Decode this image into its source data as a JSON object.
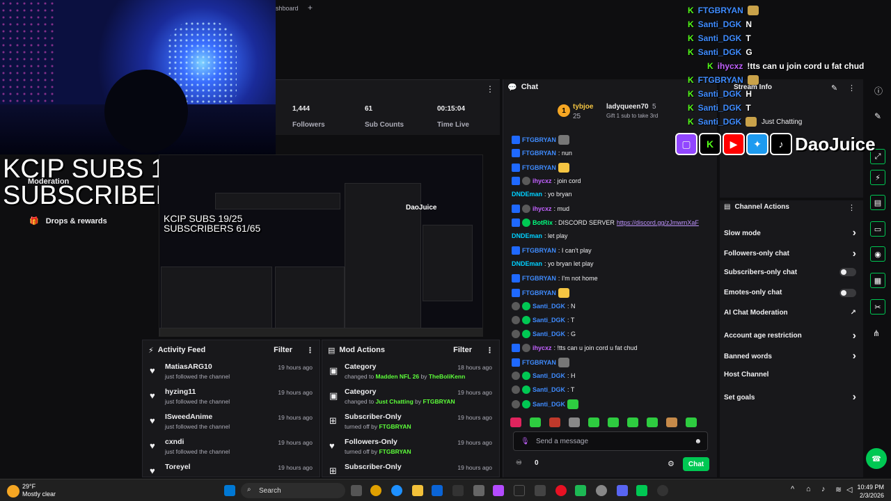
{
  "overlay": {
    "subs_line1": "KCIP SUBS 19/25",
    "subs_line2": "SUBSCRIBERS 61/65",
    "brand": "DaoJuice"
  },
  "top_chat_overlay": [
    {
      "user": "FTGBRYAN",
      "text": ""
    },
    {
      "user": "Santi_DGK",
      "text": "N"
    },
    {
      "user": "Santi_DGK",
      "text": "T"
    },
    {
      "user": "Santi_DGK",
      "text": "G"
    },
    {
      "user": "ihycxz",
      "text": "!tts can u join cord u fat chud"
    },
    {
      "user": "FTGBRYAN",
      "text": ""
    },
    {
      "user": "Santi_DGK",
      "text": "H"
    },
    {
      "user": "Santi_DGK",
      "text": "T"
    },
    {
      "user": "Santi_DGK",
      "text": ""
    }
  ],
  "browser": {
    "tab_label": "shboard"
  },
  "stats": [
    {
      "value": "1,444",
      "label": "Followers"
    },
    {
      "value": "61",
      "label": "Sub Counts"
    },
    {
      "value": "00:15:04",
      "label": "Time Live"
    }
  ],
  "sidebar": {
    "moderation": "Moderation",
    "drops": "Drops & rewards"
  },
  "activity_feed": {
    "title": "Activity Feed",
    "filter": "Filter",
    "items": [
      {
        "name": "MatiasARG10",
        "sub": "just followed the channel",
        "time": "19 hours ago"
      },
      {
        "name": "hyzing11",
        "sub": "just followed the channel",
        "time": "19 hours ago"
      },
      {
        "name": "ISweedAnime",
        "sub": "just followed the channel",
        "time": "19 hours ago"
      },
      {
        "name": "cxndi",
        "sub": "just followed the channel",
        "time": "19 hours ago"
      },
      {
        "name": "Toreyel",
        "sub": "",
        "time": "19 hours ago"
      }
    ]
  },
  "mod_actions": {
    "title": "Mod Actions",
    "filter": "Filter",
    "items": [
      {
        "name": "Category",
        "pre": "changed to",
        "highlight": "Madden NFL 26",
        "mid": "by",
        "who": "TheBoliKenn",
        "time": "18 hours ago"
      },
      {
        "name": "Category",
        "pre": "changed to",
        "highlight": "Just Chatting",
        "mid": "by",
        "who": "FTGBRYAN",
        "time": "19 hours ago"
      },
      {
        "name": "Subscriber-Only",
        "pre": "turned off by",
        "highlight": "",
        "mid": "",
        "who": "FTGBRYAN",
        "time": "19 hours ago"
      },
      {
        "name": "Followers-Only",
        "pre": "turned off by",
        "highlight": "",
        "mid": "",
        "who": "FTGBRYAN",
        "time": "19 hours ago"
      },
      {
        "name": "Subscriber-Only",
        "pre": "",
        "highlight": "",
        "mid": "",
        "who": "",
        "time": "19 hours ago"
      }
    ]
  },
  "chat": {
    "title": "Chat",
    "hype_rank": "1",
    "hype_user1": "tybjoe",
    "hype_user2": "ladyqueen70",
    "hype_amount1": "25",
    "hype_amount2": "5",
    "hype_note": "Gift 1 sub to take 3rd",
    "messages": [
      {
        "user": "FTGBRYAN",
        "text": ""
      },
      {
        "user": "FTGBRYAN",
        "text": ": nun"
      },
      {
        "user": "FTGBRYAN",
        "text": ""
      },
      {
        "user": "ihycxz",
        "text": ": join cord"
      },
      {
        "user": "DNDEman",
        "text": ": yo bryan"
      },
      {
        "user": "ihycxz",
        "text": ": mud"
      },
      {
        "user": "BotRix",
        "text": ": DISCORD SERVER ",
        "link": "https://discord.gg/zJmwmXaF"
      },
      {
        "user": "DNDEman",
        "text": ": let play"
      },
      {
        "user": "FTGBRYAN",
        "text": ": I can't play"
      },
      {
        "user": "DNDEman",
        "text": ": yo bryan let play"
      },
      {
        "user": "FTGBRYAN",
        "text": ": I'm not home"
      },
      {
        "user": "FTGBRYAN",
        "text": ""
      },
      {
        "user": "Santi_DGK",
        "text": ": N"
      },
      {
        "user": "Santi_DGK",
        "text": ": T"
      },
      {
        "user": "Santi_DGK",
        "text": ": G"
      },
      {
        "user": "ihycxz",
        "text": ": !tts can u join cord u fat chud"
      },
      {
        "user": "FTGBRYAN",
        "text": ""
      },
      {
        "user": "Santi_DGK",
        "text": ": H"
      },
      {
        "user": "Santi_DGK",
        "text": ": T"
      },
      {
        "user": "Santi_DGK",
        "text": ""
      }
    ],
    "input_placeholder": "Send a message",
    "points": "0",
    "send_label": "Chat"
  },
  "stream_info": {
    "title": "Stream Info",
    "category": "Just Chatting"
  },
  "channel_actions": {
    "title": "Channel Actions",
    "items": [
      {
        "label": "Slow mode",
        "control": "chevron"
      },
      {
        "label": "Followers-only chat",
        "control": "chevron"
      },
      {
        "label": "Subscribers-only chat",
        "control": "toggle"
      },
      {
        "label": "Emotes-only chat",
        "control": "toggle"
      },
      {
        "label": "AI Chat Moderation",
        "control": "chart"
      },
      {
        "label": "Account age restriction",
        "control": "chevron"
      },
      {
        "label": "Banned words",
        "control": "chevron"
      },
      {
        "label": "Host Channel",
        "control": "none"
      },
      {
        "label": "Set goals",
        "control": "chevron"
      }
    ]
  },
  "taskbar": {
    "weather_temp": "29°F",
    "weather_desc": "Mostly clear",
    "search": "Search",
    "time": "10:49 PM",
    "date": "2/3/2026"
  }
}
